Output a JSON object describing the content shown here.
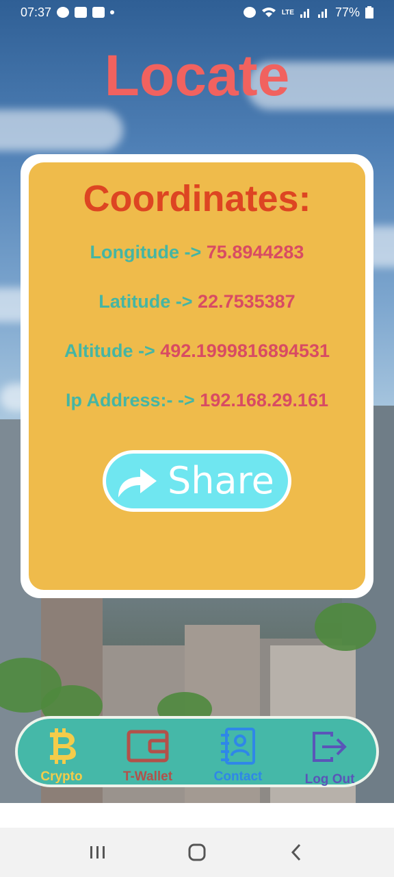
{
  "status_bar": {
    "time": "07:37",
    "battery": "77%",
    "icons": [
      "navigation-icon",
      "gallery-icon",
      "video-icon",
      "dot-icon",
      "alarm-icon",
      "wifi-icon",
      "volte-icon",
      "signal-icon",
      "signal-icon",
      "battery-icon"
    ]
  },
  "app": {
    "title": "Locate"
  },
  "card": {
    "heading": "Coordinates:",
    "rows": [
      {
        "label": "Longitude -> ",
        "value": "75.8944283"
      },
      {
        "label": "Latitude -> ",
        "value": "22.7535387"
      },
      {
        "label": "Altitude -> ",
        "value": "492.1999816894531"
      },
      {
        "label": "Ip Address:- -> ",
        "value": "192.168.29.161"
      }
    ],
    "share_label": "Share"
  },
  "bottom_nav": {
    "items": [
      {
        "label": "Crypto",
        "icon": "bitcoin-icon",
        "color": "#f4cc4a"
      },
      {
        "label": "T-Wallet",
        "icon": "wallet-icon",
        "color": "#b2514a"
      },
      {
        "label": "Contact",
        "icon": "contact-book-icon",
        "color": "#2f87e8"
      },
      {
        "label": "Log Out",
        "icon": "logout-icon",
        "color": "#5a55b8"
      }
    ]
  },
  "colors": {
    "title": "#f1625f",
    "card_bg": "#efbb4b",
    "heading": "#dd4522",
    "label": "#45b5a3",
    "value": "#d84b63",
    "share_bg": "#6fe6f0",
    "nav_bg": "#45b8a8"
  }
}
